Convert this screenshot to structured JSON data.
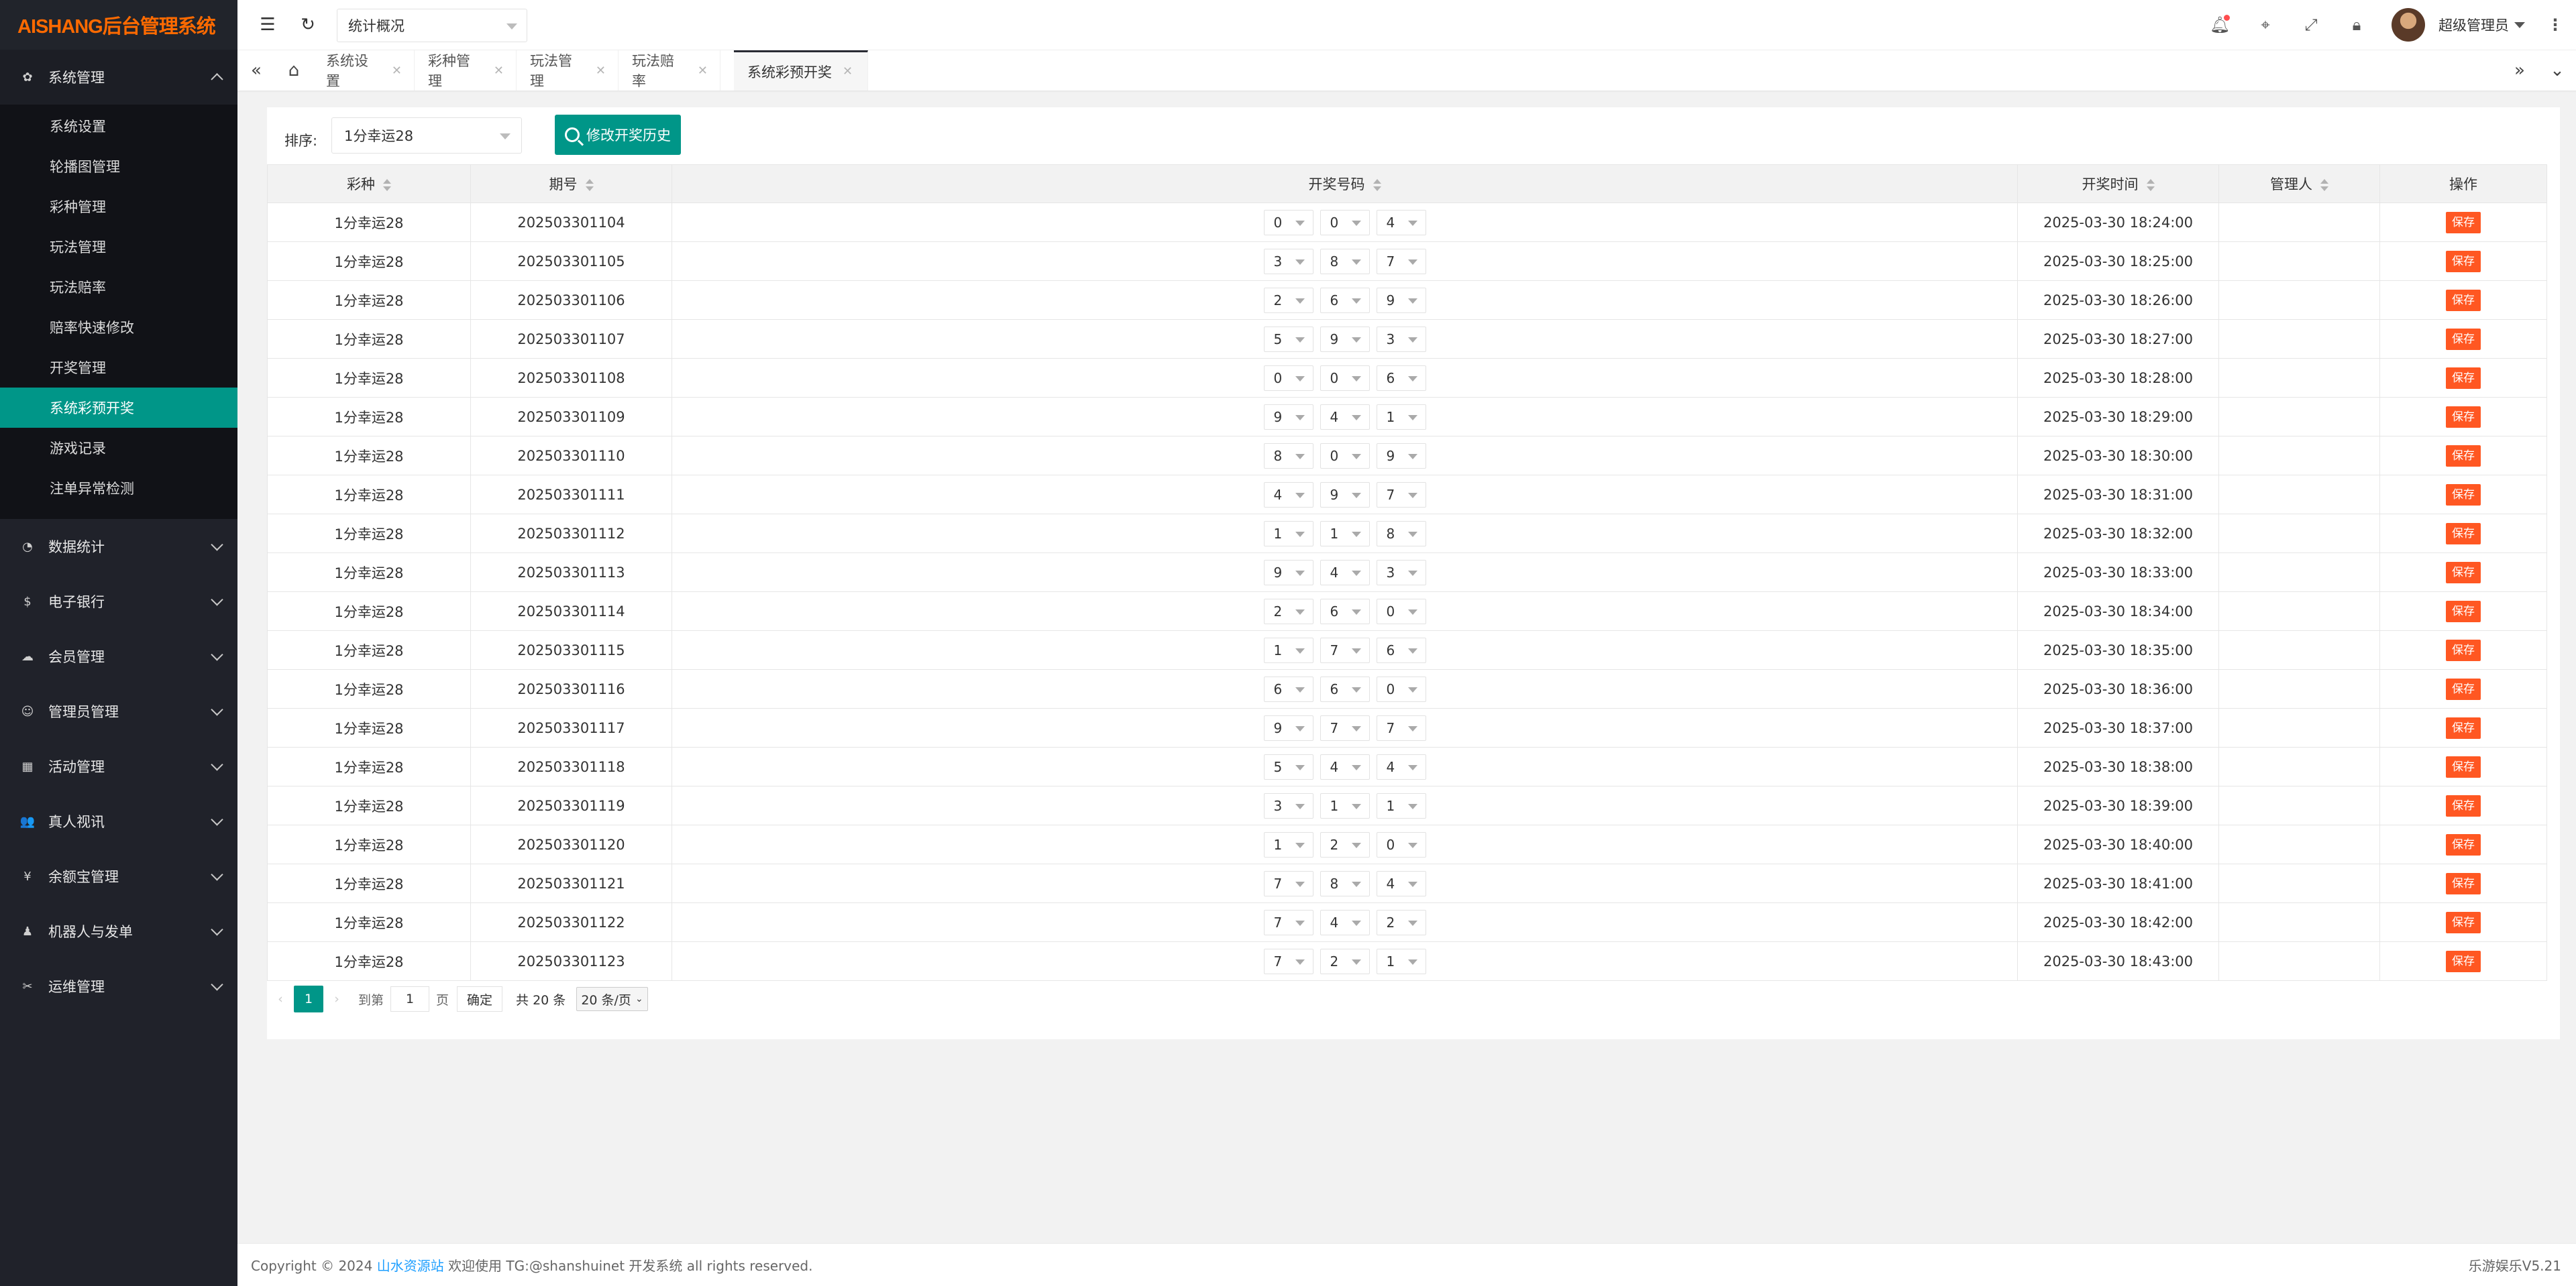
{
  "logo": "AISHANG后台管理系统",
  "header": {
    "select_value": "统计概况",
    "user_name": "超级管理员"
  },
  "sidebar": {
    "groups": [
      {
        "label": "系统管理",
        "icon": "gear-icon"
      },
      {
        "label": "数据统计",
        "icon": "dashboard-icon"
      },
      {
        "label": "电子银行",
        "icon": "dollar-icon"
      },
      {
        "label": "会员管理",
        "icon": "cloud-icon"
      },
      {
        "label": "管理员管理",
        "icon": "user-icon"
      },
      {
        "label": "活动管理",
        "icon": "calendar-icon"
      },
      {
        "label": "真人视讯",
        "icon": "users-icon"
      },
      {
        "label": "余额宝管理",
        "icon": "money-icon"
      },
      {
        "label": "机器人与发单",
        "icon": "robot-icon"
      },
      {
        "label": "运维管理",
        "icon": "tools-icon"
      }
    ],
    "sub_items": [
      "系统设置",
      "轮播图管理",
      "彩种管理",
      "玩法管理",
      "玩法赔率",
      "赔率快速修改",
      "开奖管理",
      "系统彩预开奖",
      "游戏记录",
      "注单异常检测"
    ]
  },
  "tabs": [
    "系统设置",
    "彩种管理",
    "玩法管理",
    "玩法赔率",
    "系统彩预开奖"
  ],
  "filter": {
    "label": "排序:",
    "value": "1分幸运28",
    "button": "修改开奖历史"
  },
  "table": {
    "headers": [
      "彩种",
      "期号",
      "开奖号码",
      "开奖时间",
      "管理人",
      "操作"
    ],
    "action_label": "保存",
    "rows": [
      {
        "game": "1分幸运28",
        "issue": "202503301104",
        "n1": "0",
        "n2": "0",
        "n3": "4",
        "time": "2025-03-30 18:24:00",
        "admin": ""
      },
      {
        "game": "1分幸运28",
        "issue": "202503301105",
        "n1": "3",
        "n2": "8",
        "n3": "7",
        "time": "2025-03-30 18:25:00",
        "admin": ""
      },
      {
        "game": "1分幸运28",
        "issue": "202503301106",
        "n1": "2",
        "n2": "6",
        "n3": "9",
        "time": "2025-03-30 18:26:00",
        "admin": ""
      },
      {
        "game": "1分幸运28",
        "issue": "202503301107",
        "n1": "5",
        "n2": "9",
        "n3": "3",
        "time": "2025-03-30 18:27:00",
        "admin": ""
      },
      {
        "game": "1分幸运28",
        "issue": "202503301108",
        "n1": "0",
        "n2": "0",
        "n3": "6",
        "time": "2025-03-30 18:28:00",
        "admin": ""
      },
      {
        "game": "1分幸运28",
        "issue": "202503301109",
        "n1": "9",
        "n2": "4",
        "n3": "1",
        "time": "2025-03-30 18:29:00",
        "admin": ""
      },
      {
        "game": "1分幸运28",
        "issue": "202503301110",
        "n1": "8",
        "n2": "0",
        "n3": "9",
        "time": "2025-03-30 18:30:00",
        "admin": ""
      },
      {
        "game": "1分幸运28",
        "issue": "202503301111",
        "n1": "4",
        "n2": "9",
        "n3": "7",
        "time": "2025-03-30 18:31:00",
        "admin": ""
      },
      {
        "game": "1分幸运28",
        "issue": "202503301112",
        "n1": "1",
        "n2": "1",
        "n3": "8",
        "time": "2025-03-30 18:32:00",
        "admin": ""
      },
      {
        "game": "1分幸运28",
        "issue": "202503301113",
        "n1": "9",
        "n2": "4",
        "n3": "3",
        "time": "2025-03-30 18:33:00",
        "admin": ""
      },
      {
        "game": "1分幸运28",
        "issue": "202503301114",
        "n1": "2",
        "n2": "6",
        "n3": "0",
        "time": "2025-03-30 18:34:00",
        "admin": ""
      },
      {
        "game": "1分幸运28",
        "issue": "202503301115",
        "n1": "1",
        "n2": "7",
        "n3": "6",
        "time": "2025-03-30 18:35:00",
        "admin": ""
      },
      {
        "game": "1分幸运28",
        "issue": "202503301116",
        "n1": "6",
        "n2": "6",
        "n3": "0",
        "time": "2025-03-30 18:36:00",
        "admin": ""
      },
      {
        "game": "1分幸运28",
        "issue": "202503301117",
        "n1": "9",
        "n2": "7",
        "n3": "7",
        "time": "2025-03-30 18:37:00",
        "admin": ""
      },
      {
        "game": "1分幸运28",
        "issue": "202503301118",
        "n1": "5",
        "n2": "4",
        "n3": "4",
        "time": "2025-03-30 18:38:00",
        "admin": ""
      },
      {
        "game": "1分幸运28",
        "issue": "202503301119",
        "n1": "3",
        "n2": "1",
        "n3": "1",
        "time": "2025-03-30 18:39:00",
        "admin": ""
      },
      {
        "game": "1分幸运28",
        "issue": "202503301120",
        "n1": "1",
        "n2": "2",
        "n3": "0",
        "time": "2025-03-30 18:40:00",
        "admin": ""
      },
      {
        "game": "1分幸运28",
        "issue": "202503301121",
        "n1": "7",
        "n2": "8",
        "n3": "4",
        "time": "2025-03-30 18:41:00",
        "admin": ""
      },
      {
        "game": "1分幸运28",
        "issue": "202503301122",
        "n1": "7",
        "n2": "4",
        "n3": "2",
        "time": "2025-03-30 18:42:00",
        "admin": ""
      },
      {
        "game": "1分幸运28",
        "issue": "202503301123",
        "n1": "7",
        "n2": "2",
        "n3": "1",
        "time": "2025-03-30 18:43:00",
        "admin": ""
      }
    ]
  },
  "pagination": {
    "current": "1",
    "goto_label": "到第",
    "goto_value": "1",
    "page_label": "页",
    "confirm": "确定",
    "total": "共 20 条",
    "page_size": "20 条/页"
  },
  "footer": {
    "copyright_prefix": "Copyright © 2024",
    "link": "山水资源站",
    "suffix": "欢迎使用 TG:@shanshuinet 开发系统 all rights reserved.",
    "version": "乐游娱乐V5.21"
  },
  "colors": {
    "accent": "#009688",
    "sidebar_bg": "#20222a",
    "logo": "#ff6a00",
    "save_button": "#ff5722",
    "link": "#1e9fff"
  }
}
